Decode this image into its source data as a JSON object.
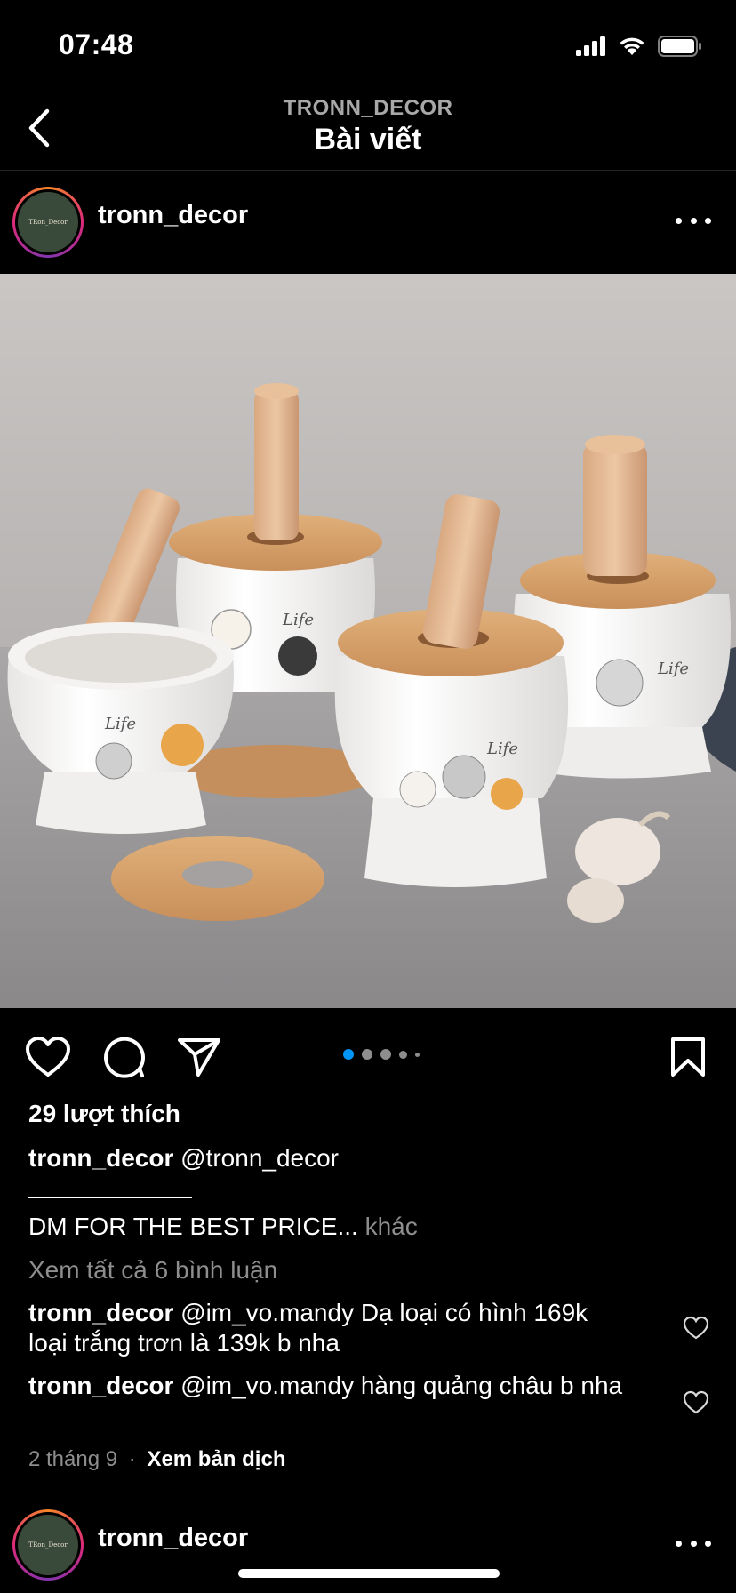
{
  "status_bar": {
    "time": "07:48"
  },
  "nav": {
    "subtitle": "TRONN_DECOR",
    "title": "Bài viết"
  },
  "post": {
    "username": "tronn_decor",
    "avatar_text": "TRon_Decor",
    "photo_labels": [
      "Life",
      "Life",
      "Life",
      "Life"
    ],
    "carousel": {
      "count": 5,
      "active_index": 0
    },
    "likes": "29 lượt thích",
    "caption_mention": "@tronn_decor",
    "caption_rule": "———————",
    "caption_text": "DM FOR THE BEST PRICE...",
    "caption_more": "khác",
    "view_all_comments": "Xem tất cả 6 bình luận",
    "comments": [
      {
        "user": "tronn_decor",
        "text": "@im_vo.mandy Dạ loại có hình 169k loại trắng trơn là 139k b nha"
      },
      {
        "user": "tronn_decor",
        "text": "@im_vo.mandy hàng quảng châu b nha"
      }
    ],
    "date": "2 tháng 9",
    "separator": "·",
    "translate": "Xem bản dịch"
  },
  "next_post": {
    "username": "tronn_decor",
    "avatar_text": "TRon_Decor"
  },
  "colors": {
    "background": "#000000",
    "muted": "#8e8e8e",
    "active_dot": "#0095f6",
    "divider": "#262626"
  },
  "icons": [
    "chevron-left-icon",
    "signal-icon",
    "wifi-icon",
    "battery-icon",
    "more-icon",
    "heart-icon",
    "comment-icon",
    "share-icon",
    "bookmark-icon"
  ]
}
